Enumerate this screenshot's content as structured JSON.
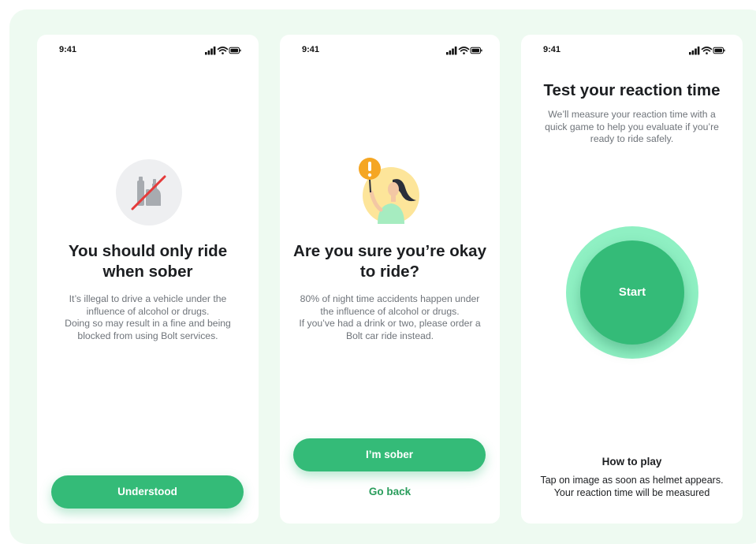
{
  "status_bar": {
    "time": "9:41",
    "icons": [
      "signal-icon",
      "wifi-icon",
      "battery-icon"
    ]
  },
  "colors": {
    "accent": "#34bb78",
    "accent_dark": "#2a9d5c",
    "title": "#1c1e21",
    "body": "#6f747a",
    "background": "#eefaf1",
    "ring": "#8ff0c3",
    "warning": "#f5a623"
  },
  "screen1": {
    "icon": "no-alcohol-icon",
    "title_line1": "You should only ride",
    "title_line2": "when sober",
    "body_line1": "It’s illegal to drive a vehicle under the",
    "body_line2": "influence of alcohol or drugs.",
    "body_line3": "Doing so may result in a fine and being",
    "body_line4": "blocked from using Bolt services.",
    "primary_button": "Understood"
  },
  "screen2": {
    "icon": "warning-person-illustration",
    "title_line1": "Are you sure you’re okay",
    "title_line2": "to ride?",
    "body_line1": "80% of night time accidents happen under",
    "body_line2": "the influence of alcohol or drugs.",
    "body_line3": "If you’ve had a drink or two, please order a",
    "body_line4": "Bolt car ride instead.",
    "primary_button": "I’m sober",
    "secondary_button": "Go back"
  },
  "screen3": {
    "title": "Test your reaction time",
    "body_line1": "We’ll measure your reaction time with a",
    "body_line2": "quick game to help you evaluate if you’re",
    "body_line3": "ready to ride safely.",
    "start_button": "Start",
    "howto_title": "How to play",
    "howto_line1": "Tap on image as soon as helmet appears.",
    "howto_line2": "Your reaction time will be measured"
  }
}
